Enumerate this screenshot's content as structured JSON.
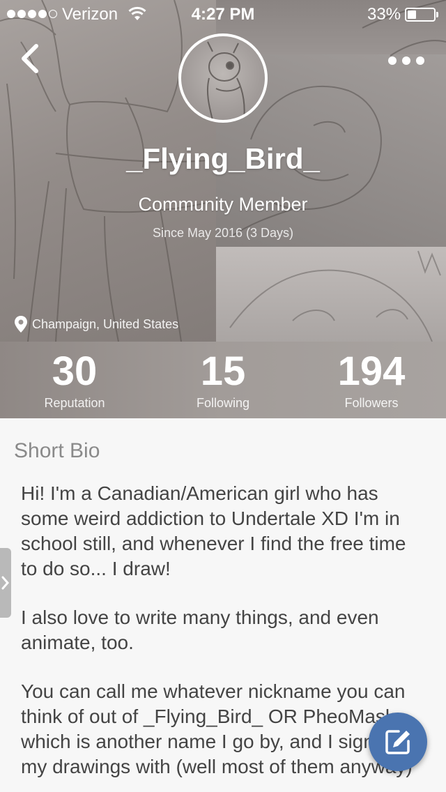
{
  "status_bar": {
    "carrier": "Verizon",
    "time": "4:27 PM",
    "battery_percent": "33%",
    "battery_level": 0.33,
    "signal_bars": 4
  },
  "nav": {
    "back_icon": "chevron-left-icon",
    "more_icon": "more-dots-icon"
  },
  "profile": {
    "username": "_Flying_Bird_",
    "role": "Community Member",
    "since": "Since May 2016 (3 Days)",
    "location": "Champaign, United States",
    "location_icon": "location-pin-icon"
  },
  "stats": [
    {
      "value": "30",
      "label": "Reputation"
    },
    {
      "value": "15",
      "label": "Following"
    },
    {
      "value": "194",
      "label": "Followers"
    }
  ],
  "bio": {
    "heading": "Short Bio",
    "paragraphs": [
      "Hi! I'm a Canadian/American girl who has some weird addiction to Undertale XD I'm in school still, and whenever I find the free time to do so... I draw!",
      "I also love to write many things, and even animate, too.",
      "You can call me whatever nickname you can think of out of _Flying_Bird_ OR PheoMask, which is another name I go by, and I sign all of my drawings with (well most of them anyway)"
    ]
  },
  "fab": {
    "icon": "edit-icon"
  },
  "colors": {
    "accent": "#4a74b0",
    "heading": "#8a8a8a",
    "body_text": "#444444",
    "background": "#f7f7f7"
  }
}
